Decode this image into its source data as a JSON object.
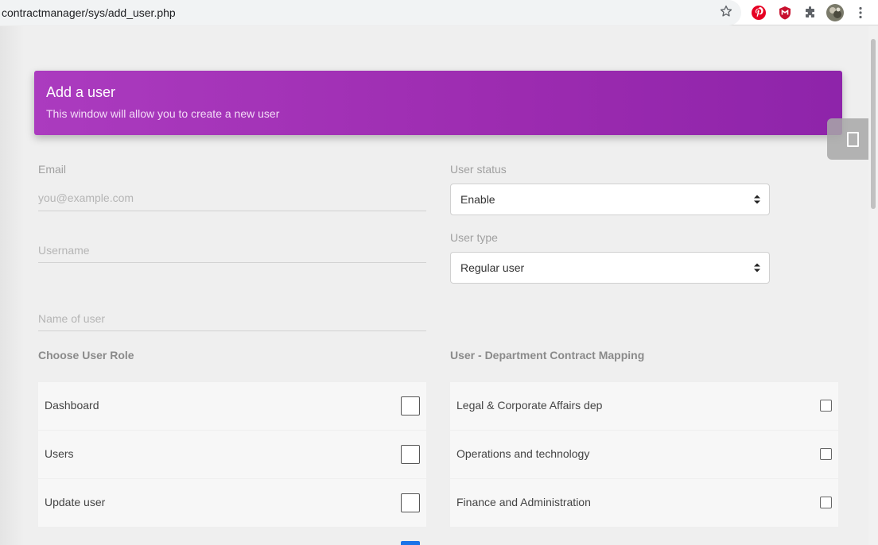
{
  "browser": {
    "url": "contractmanager/sys/add_user.php"
  },
  "header": {
    "title": "Add a user",
    "subtitle": "This window will allow you to create a new user"
  },
  "form": {
    "email": {
      "label": "Email",
      "placeholder": "you@example.com"
    },
    "username": {
      "placeholder": "Username"
    },
    "name_of_user": {
      "placeholder": "Name of user"
    },
    "user_status": {
      "label": "User status",
      "value": "Enable"
    },
    "user_type": {
      "label": "User type",
      "value": "Regular user"
    }
  },
  "roles": {
    "title": "Choose User Role",
    "items": [
      {
        "label": "Dashboard"
      },
      {
        "label": "Users"
      },
      {
        "label": "Update user"
      }
    ]
  },
  "departments": {
    "title": "User - Department Contract Mapping",
    "items": [
      {
        "label": "Legal & Corporate Affairs dep"
      },
      {
        "label": "Operations and technology"
      },
      {
        "label": "Finance and Administration"
      }
    ]
  },
  "colors": {
    "header_start": "#ab3bbf",
    "header_end": "#8e24aa",
    "accent_blue": "#1a73e8"
  }
}
